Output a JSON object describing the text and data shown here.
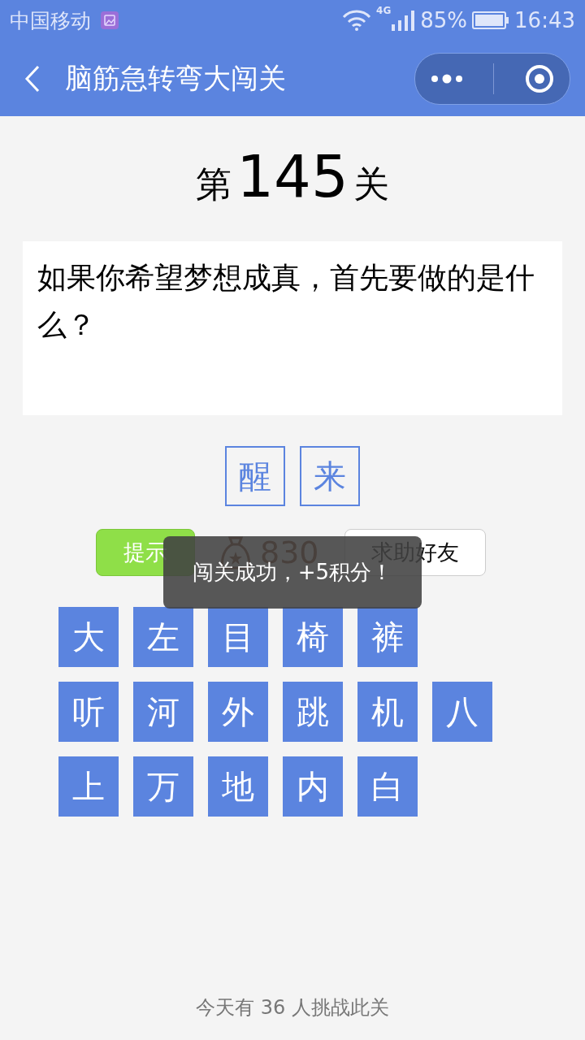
{
  "status_bar": {
    "carrier": "中国移动",
    "network": "4G",
    "battery": "85%",
    "time": "16:43"
  },
  "nav": {
    "title": "脑筋急转弯大闯关"
  },
  "level": {
    "prefix": "第",
    "number": "145",
    "suffix": "关"
  },
  "question": "如果你希望梦想成真，首先要做的是什么？",
  "answer": [
    "醒",
    "来"
  ],
  "actions": {
    "hint": "提示",
    "coins": "830",
    "help": "求助好友"
  },
  "toast": "闯关成功，+5积分！",
  "letters": [
    [
      "大",
      "左",
      "目",
      "椅",
      "裤"
    ],
    [
      "听",
      "河",
      "外",
      "跳",
      "机",
      "八"
    ],
    [
      "上",
      "万",
      "地",
      "内",
      "白"
    ]
  ],
  "footer": "今天有 36 人挑战此关"
}
